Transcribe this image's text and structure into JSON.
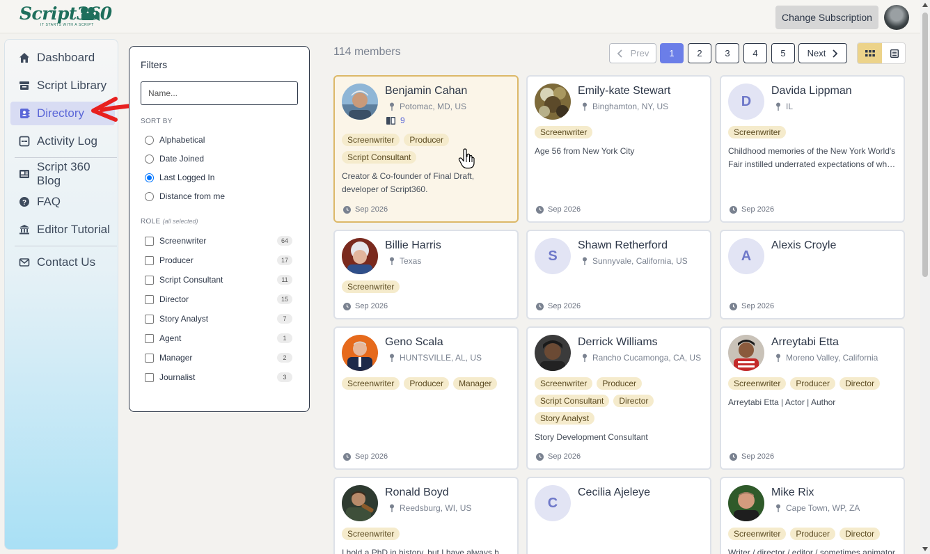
{
  "header": {
    "logo_text": "Script360",
    "logo_tagline": "IT STARTS WITH A SCRIPT",
    "change_subscription": "Change Subscription"
  },
  "sidebar": {
    "items": [
      {
        "label": "Dashboard",
        "icon": "home-icon"
      },
      {
        "label": "Script Library",
        "icon": "archive-icon"
      },
      {
        "label": "Directory",
        "icon": "address-book-icon",
        "active": true
      },
      {
        "label": "Activity Log",
        "icon": "log-icon"
      },
      {
        "label": "Script 360 Blog",
        "icon": "newspaper-icon"
      },
      {
        "label": "FAQ",
        "icon": "question-icon"
      },
      {
        "label": "Editor Tutorial",
        "icon": "institution-icon"
      },
      {
        "label": "Contact Us",
        "icon": "envelope-icon"
      }
    ]
  },
  "filters": {
    "title": "Filters",
    "name_placeholder": "Name...",
    "sort_by_label": "SORT BY",
    "sort_options": [
      "Alphabetical",
      "Date Joined",
      "Last Logged In",
      "Distance from me"
    ],
    "sort_selected": "Last Logged In",
    "role_label": "ROLE",
    "role_sub": "(all selected)",
    "roles": [
      {
        "label": "Screenwriter",
        "count": "64"
      },
      {
        "label": "Producer",
        "count": "17"
      },
      {
        "label": "Script Consultant",
        "count": "11"
      },
      {
        "label": "Director",
        "count": "15"
      },
      {
        "label": "Story Analyst",
        "count": "7"
      },
      {
        "label": "Agent",
        "count": "1"
      },
      {
        "label": "Manager",
        "count": "2"
      },
      {
        "label": "Journalist",
        "count": "3"
      }
    ]
  },
  "directory": {
    "members_count": "114 members",
    "pagination": {
      "prev": "Prev",
      "pages": [
        "1",
        "2",
        "3",
        "4",
        "5"
      ],
      "current": "1",
      "next": "Next"
    },
    "cards": [
      {
        "name": "Benjamin Cahan",
        "location": "Potomac, MD, US",
        "scripts": "9",
        "tags": [
          "Screenwriter",
          "Producer",
          "Script Consultant"
        ],
        "bio": "Creator & Co-founder of Final Draft, developer of Script360.",
        "date": "Sep 2026",
        "avatar": "photo"
      },
      {
        "name": "Emily-kate Stewart",
        "location": "Binghamton, NY, US",
        "tags": [
          "Screenwriter"
        ],
        "bio": "Age 56 from New York City",
        "date": "Sep 2026",
        "avatar": "photo"
      },
      {
        "name": "Davida Lippman",
        "location": "IL",
        "initial": "D",
        "tags": [
          "Screenwriter"
        ],
        "bio": "Childhood memories of the New York World's Fair instilled underrated expectations of what wonder...",
        "date": "Sep 2026",
        "avatar": "initial"
      },
      {
        "name": "Billie Harris",
        "location": "Texas",
        "tags": [
          "Screenwriter"
        ],
        "bio": "",
        "date": "Sep 2026",
        "avatar": "photo"
      },
      {
        "name": "Shawn Retherford",
        "location": "Sunnyvale, California, US",
        "initial": "S",
        "tags": [],
        "bio": "",
        "date": "Sep 2026",
        "avatar": "initial"
      },
      {
        "name": "Alexis Croyle",
        "location": "",
        "initial": "A",
        "tags": [],
        "bio": "",
        "date": "Sep 2026",
        "avatar": "initial"
      },
      {
        "name": "Geno Scala",
        "location": "HUNTSVILLE, AL, US",
        "tags": [
          "Screenwriter",
          "Producer",
          "Manager"
        ],
        "bio": "",
        "date": "Sep 2026",
        "avatar": "photo"
      },
      {
        "name": "Derrick Williams",
        "location": "Rancho Cucamonga, CA, US",
        "tags": [
          "Screenwriter",
          "Producer",
          "Script Consultant",
          "Director",
          "Story Analyst"
        ],
        "bio": "Story Development Consultant",
        "date": "Sep 2026",
        "avatar": "photo"
      },
      {
        "name": "Arreytabi Etta",
        "location": "Moreno Valley, California",
        "tags": [
          "Screenwriter",
          "Producer",
          "Director"
        ],
        "bio": "Arreytabi Etta | Actor | Author",
        "date": "Sep 2026",
        "avatar": "photo"
      },
      {
        "name": "Ronald Boyd",
        "location": "Reedsburg, WI, US",
        "tags": [
          "Screenwriter"
        ],
        "bio": "I hold a PhD in history, but I have always had an",
        "date": "",
        "avatar": "photo"
      },
      {
        "name": "Cecilia Ajeleye",
        "location": "",
        "initial": "C",
        "tags": [],
        "bio": "",
        "date": "",
        "avatar": "initial"
      },
      {
        "name": "Mike Rix",
        "location": "Cape Town, WP, ZA",
        "tags": [
          "Screenwriter",
          "Producer",
          "Director"
        ],
        "bio": "Writer / director / editor / sometimes animator",
        "date": "",
        "avatar": "photo"
      }
    ]
  },
  "colors": {
    "accent": "#5b67d8",
    "tag_bg": "#f5ebcc",
    "highlight_card_bg": "#fbf5e8",
    "highlight_card_border": "#dcb868",
    "view_toggle_active": "#ecd38a"
  }
}
